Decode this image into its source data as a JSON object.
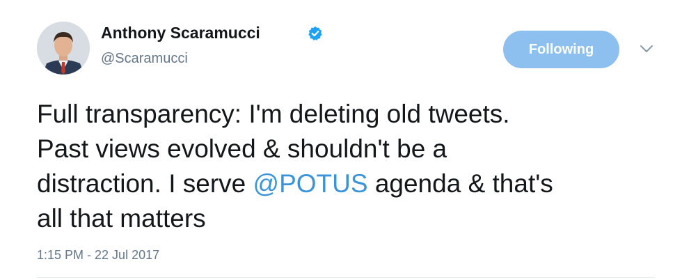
{
  "author": {
    "display_name": "Anthony Scaramucci",
    "handle": "@Scaramucci",
    "verified": true
  },
  "follow_button": {
    "label": "Following"
  },
  "menu": {
    "icon": "chevron-down-icon"
  },
  "tweet": {
    "line1": "Full transparency: I'm deleting old tweets.",
    "line2": "Past views evolved & shouldn't be a",
    "line3_before": "distraction. I serve ",
    "mention": "@POTUS",
    "line3_after": " agenda & that's",
    "line4": "all that matters"
  },
  "meta": {
    "timestamp": "1:15 PM - 22 Jul 2017"
  },
  "colors": {
    "follow_button_bg": "#8ec0ef",
    "mention": "#3b94d9",
    "verified_badge": "#1da1f2",
    "text": "#14171a",
    "secondary_text": "#657786"
  }
}
